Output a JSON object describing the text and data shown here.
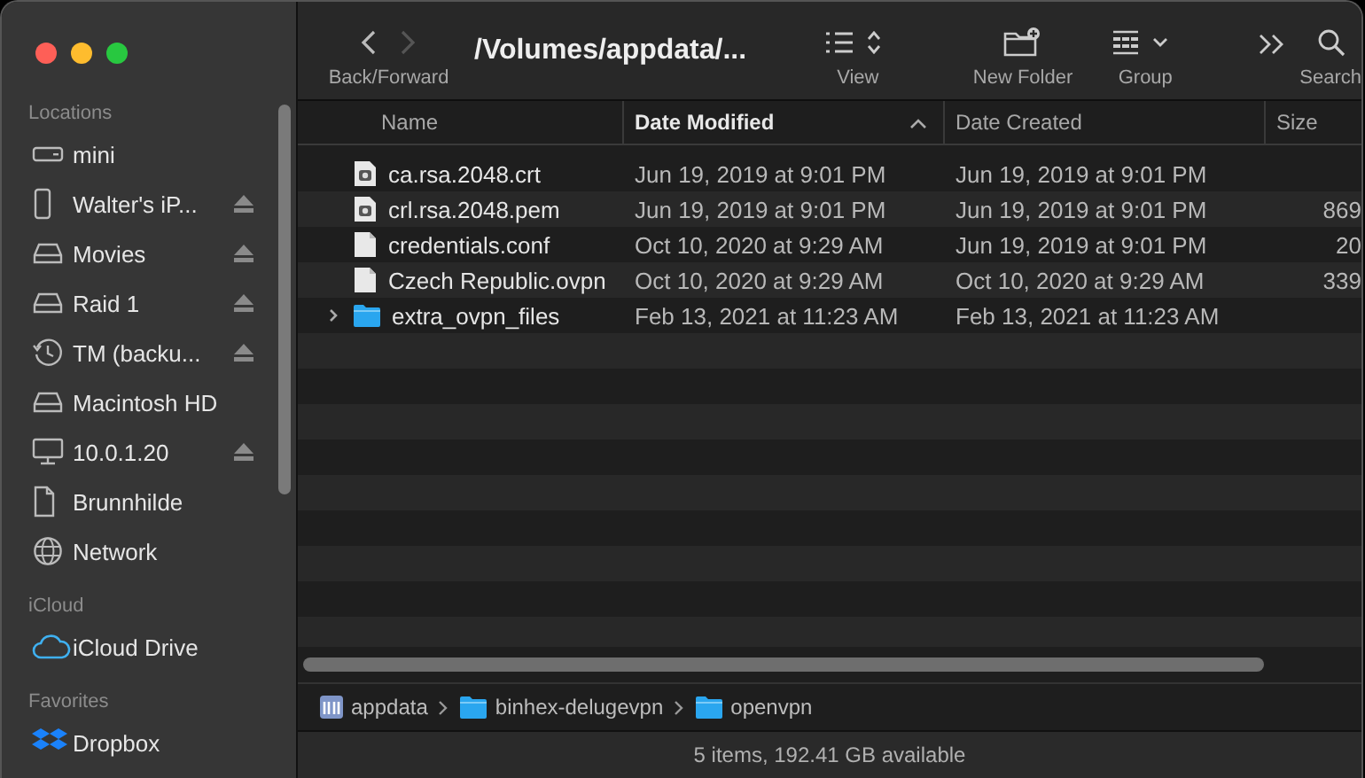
{
  "window": {
    "title": "/Volumes/appdata/..."
  },
  "sidebar": {
    "sections": [
      {
        "heading": "Locations",
        "items": [
          {
            "label": "mini",
            "kind": "drive",
            "eject": false
          },
          {
            "label": "Walter's iP...",
            "kind": "phone",
            "eject": true
          },
          {
            "label": "Movies",
            "kind": "disk",
            "eject": true
          },
          {
            "label": "Raid 1",
            "kind": "disk",
            "eject": true
          },
          {
            "label": "TM (backu...",
            "kind": "clock",
            "eject": true
          },
          {
            "label": "Macintosh HD",
            "kind": "disk",
            "eject": false
          },
          {
            "label": "10.0.1.20",
            "kind": "monitor",
            "eject": true
          },
          {
            "label": "Brunnhilde",
            "kind": "document",
            "eject": false
          },
          {
            "label": "Network",
            "kind": "globe",
            "eject": false
          }
        ]
      },
      {
        "heading": "iCloud",
        "items": [
          {
            "label": "iCloud Drive",
            "kind": "cloud",
            "eject": false
          }
        ]
      },
      {
        "heading": "Favorites",
        "items": [
          {
            "label": "Dropbox",
            "kind": "dropbox",
            "eject": false
          }
        ]
      }
    ]
  },
  "toolbar": {
    "nav": {
      "label": "Back/Forward",
      "back_disabled": false,
      "forward_disabled": true
    },
    "buttons": [
      {
        "label": "View",
        "kind": "view"
      },
      {
        "label": "New Folder",
        "kind": "newfolder"
      },
      {
        "label": "Group",
        "kind": "group"
      },
      {
        "label": "Search",
        "kind": "search"
      }
    ]
  },
  "table": {
    "columns": [
      {
        "label": "Name",
        "sorted": false
      },
      {
        "label": "Date Modified",
        "sorted": true
      },
      {
        "label": "Date Created",
        "sorted": false
      },
      {
        "label": "Size",
        "sorted": false
      }
    ],
    "rows": [
      {
        "name": "ca.rsa.2048.crt",
        "kind": "cert",
        "modified": "Jun 19, 2019 at 9:01 PM",
        "created": "Jun 19, 2019 at 9:01 PM"
      },
      {
        "name": "crl.rsa.2048.pem",
        "kind": "cert",
        "modified": "Jun 19, 2019 at 9:01 PM",
        "created": "Jun 19, 2019 at 9:01 PM",
        "size": "869"
      },
      {
        "name": "credentials.conf",
        "kind": "document",
        "modified": "Oct 10, 2020 at 9:29 AM",
        "created": "Jun 19, 2019 at 9:01 PM",
        "size": "20"
      },
      {
        "name": "Czech Republic.ovpn",
        "kind": "document",
        "modified": "Oct 10, 2020 at 9:29 AM",
        "created": "Oct 10, 2020 at 9:29 AM",
        "size": "339"
      },
      {
        "name": "extra_ovpn_files",
        "kind": "folder",
        "expanded": false,
        "modified": "Feb 13, 2021 at 11:23 AM",
        "created": "Feb 13, 2021 at 11:23 AM"
      }
    ]
  },
  "path_bar": [
    {
      "label": "appdata",
      "kind": "share"
    },
    {
      "label": "binhex-delugevpn",
      "kind": "folder"
    },
    {
      "label": "openvpn",
      "kind": "folder"
    }
  ],
  "status_bar": "5 items, 192.41 GB available"
}
